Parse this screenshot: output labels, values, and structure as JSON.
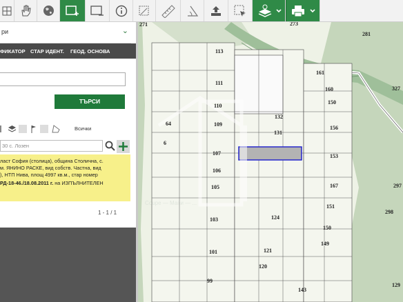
{
  "toolbar": {
    "icons": [
      "grid-icon",
      "hand-pan-icon",
      "globe-icon",
      "add-area-icon",
      "window-icon",
      "info-icon",
      "measure-area-icon",
      "ruler-icon",
      "measure-angle-icon",
      "upload-icon",
      "select-icon",
      "layers-icon",
      "print-icon"
    ]
  },
  "panel": {
    "dropdown_label": "ри",
    "tabs": [
      "ФИКАТОР",
      "СТАР ИДЕНТ.",
      "ГЕОД. ОСНОВА"
    ],
    "search_button": "ТЪРСИ",
    "filter_all": "Всички",
    "result_search_value": "30 с. Лозен",
    "result_lines": [
      "ласт София (столица), община Столична, с.",
      "м. ЯНИНО РАСКЕ, вид собств. Частна, вид",
      "), НТП Нива, площ 4997 кв.м., стар номер"
    ],
    "result_order_bold": "РД-18-46./18.08.2011 г.",
    "result_order_rest": " на ИЗПЪЛНИТЕЛЕН",
    "pager": "1 - 1 / 1"
  },
  "map": {
    "parcels": [
      "271",
      "273",
      "281",
      "113",
      "161",
      "327",
      "111",
      "160",
      "150",
      "110",
      "64",
      "109",
      "132",
      "156",
      "6",
      "131",
      "107",
      "153",
      "106",
      "105",
      "167",
      "151",
      "297",
      "298",
      "103",
      "124",
      "150",
      "149",
      "101",
      "121",
      "120",
      "99",
      "143",
      "129"
    ],
    "watermark": "Coupe — Мапи — ..."
  },
  "colors": {
    "accent_green": "#2f8a47",
    "selected_parcel": "#b3b3b3",
    "result_yellow": "#f7f08a",
    "map_green": "#c9d9bf"
  }
}
